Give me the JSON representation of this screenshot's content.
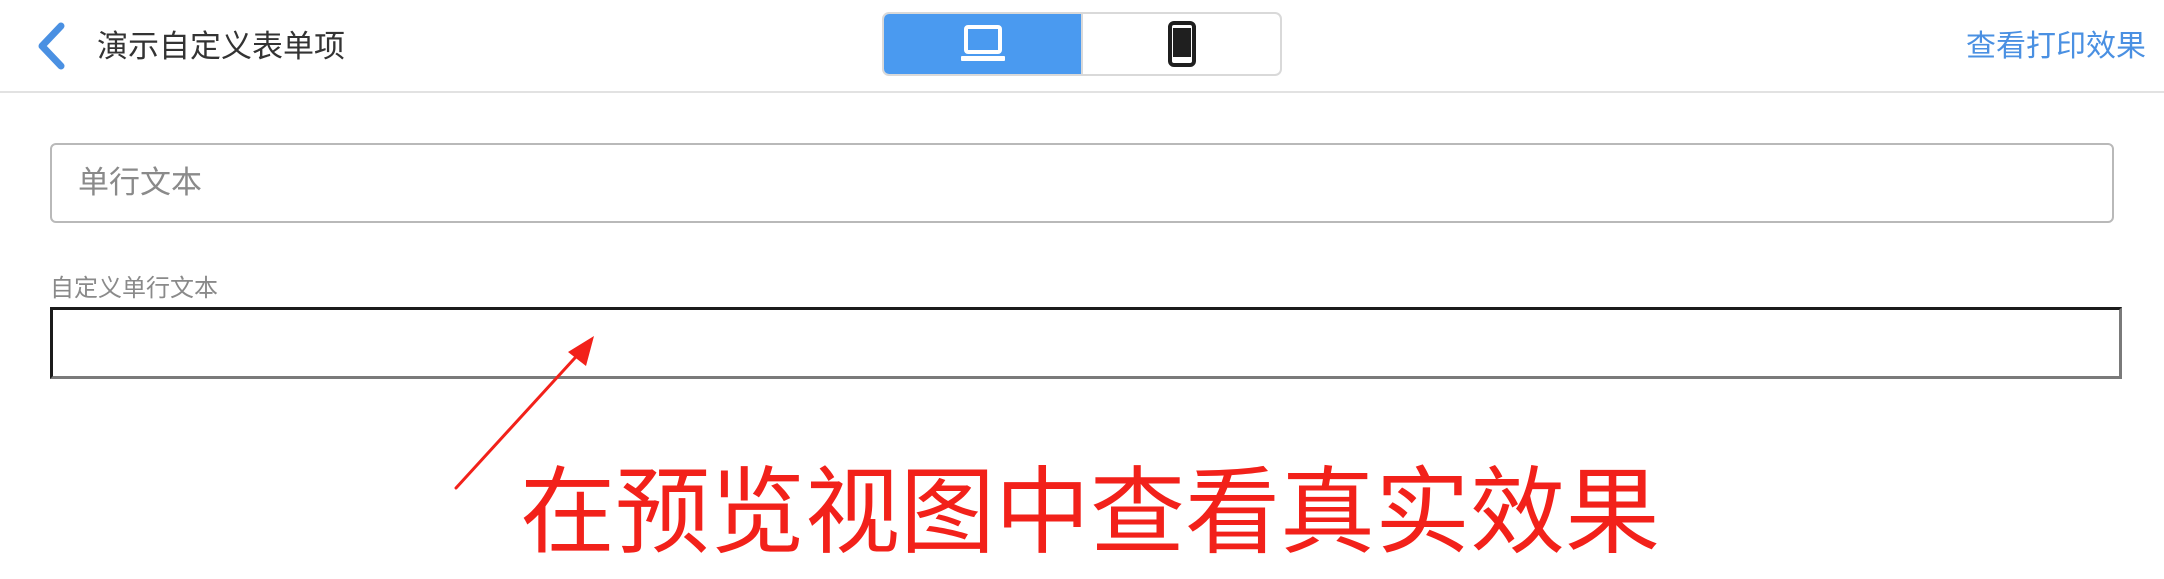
{
  "header": {
    "title": "演示自定义表单项",
    "back_icon": "chevron-left-icon",
    "view_toggle": {
      "options": [
        {
          "name": "desktop",
          "icon": "desktop-monitor-icon",
          "active": true
        },
        {
          "name": "mobile",
          "icon": "mobile-phone-icon",
          "active": false
        }
      ],
      "active_color": "#4a9af0"
    },
    "print_preview_label": "查看打印效果",
    "link_color": "#4a90e2"
  },
  "form": {
    "single_line_field": {
      "placeholder": "单行文本"
    },
    "custom_field": {
      "label": "自定义单行文本",
      "value": ""
    }
  },
  "annotation": {
    "text": "在预览视图中查看真实效果",
    "color": "#f2211a"
  }
}
